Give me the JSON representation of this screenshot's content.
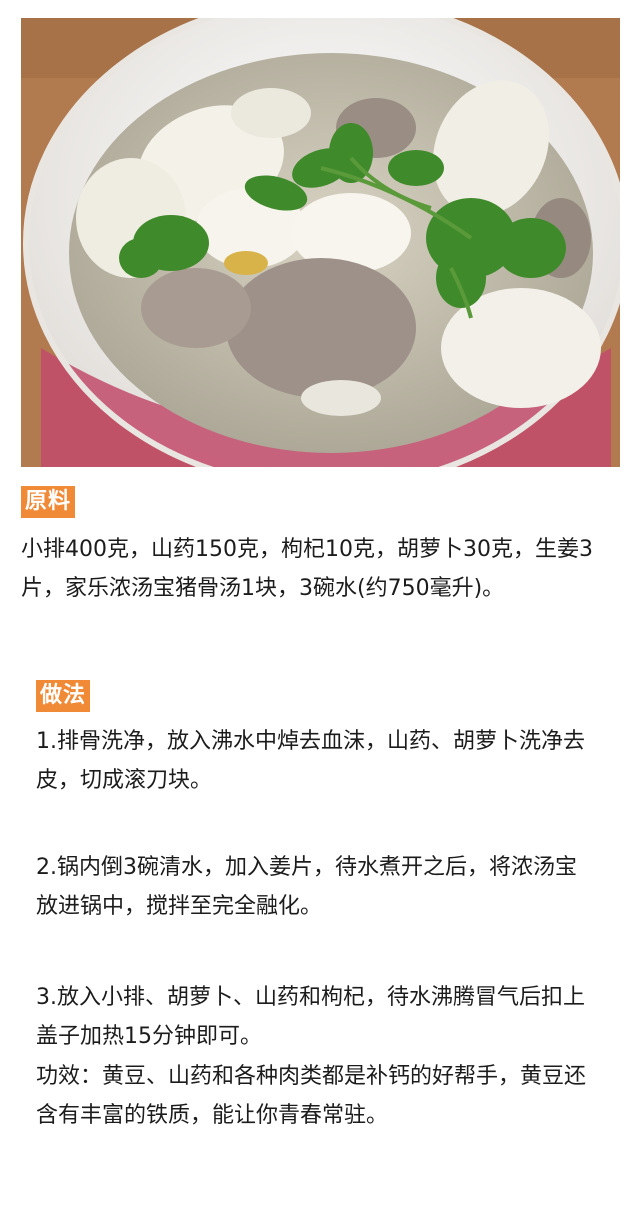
{
  "photo": {
    "subject": "bowl of pork rib soup with yam and cilantro",
    "colors": {
      "table": "#b27a4f",
      "bowl_rim": "#f4f1ee",
      "soup": "#c9c4b3",
      "yam": "#f3f1e8",
      "meat": "#9d9189",
      "cilantro": "#3f8a2a",
      "bowl_band": "#c24b6b"
    }
  },
  "ingredients": {
    "heading": "原料",
    "text": "小排400克，山药150克，枸杞10克，胡萝卜30克，生姜3片，家乐浓汤宝猪骨汤1块，3碗水(约750毫升)。"
  },
  "method": {
    "heading": "做法",
    "steps": [
      "1.排骨洗净，放入沸水中焯去血沫，山药、胡萝卜洗净去皮，切成滚刀块。",
      "2.锅内倒3碗清水，加入姜片，待水煮开之后，将浓汤宝放进锅中，搅拌至完全融化。",
      "3.放入小排、胡萝卜、山药和枸杞，待水沸腾冒气后扣上盖子加热15分钟即可。"
    ],
    "effect": "功效：黄豆、山药和各种肉类都是补钙的好帮手，黄豆还含有丰富的铁质，能让你青春常驻。"
  },
  "colors": {
    "accent": "#f08a36",
    "text": "#1c1c1c",
    "background": "#ffffff"
  }
}
